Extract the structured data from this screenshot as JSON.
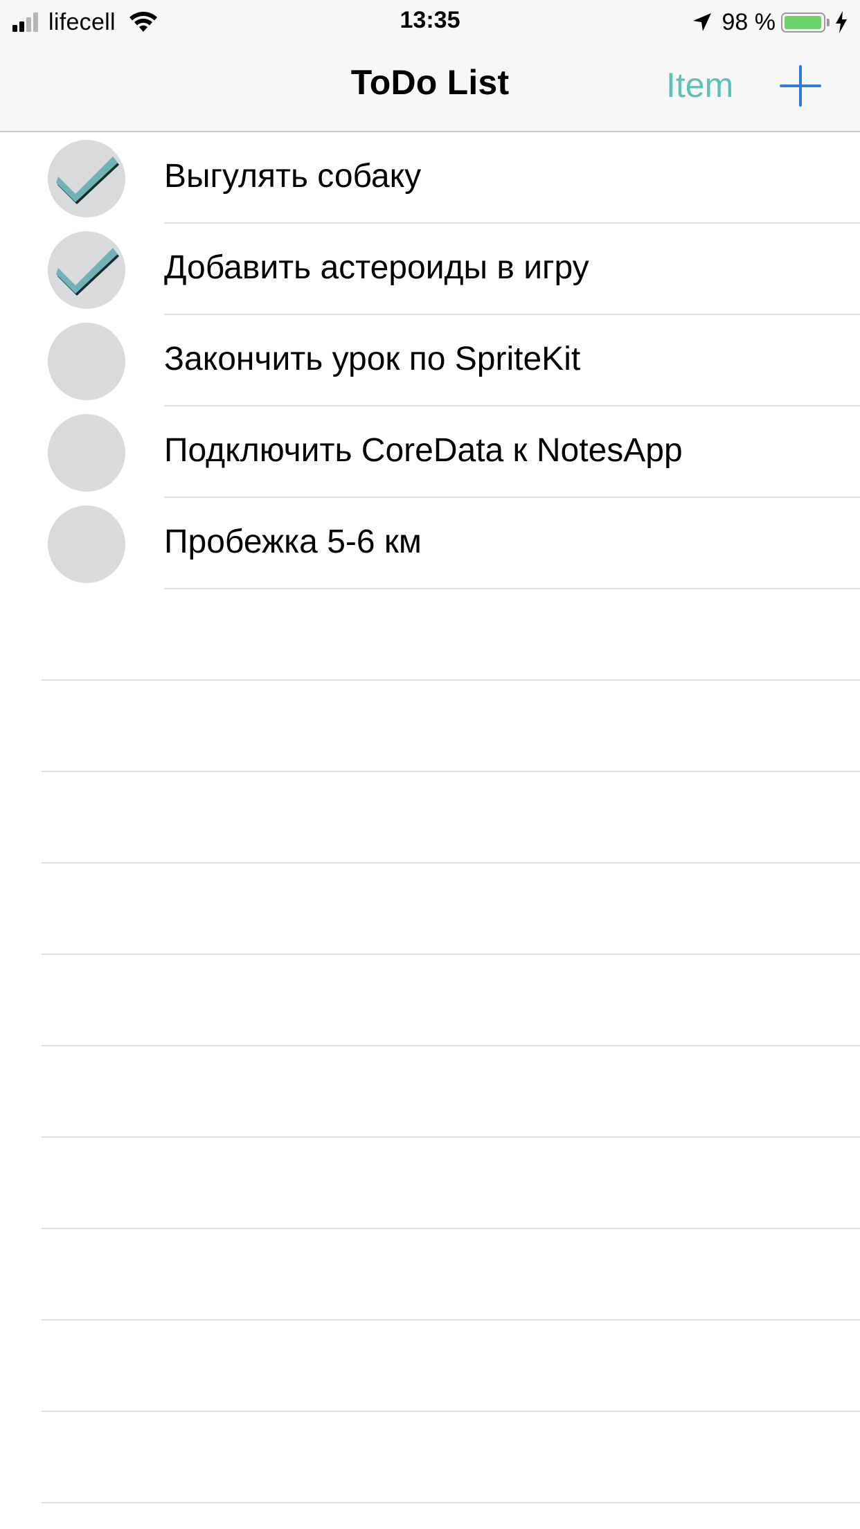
{
  "status_bar": {
    "carrier": "lifecell",
    "time": "13:35",
    "battery_percent": "98 %",
    "battery_level": 0.98,
    "signal_bars_active": 2,
    "signal_bars_total": 4,
    "icons": [
      "signal-icon",
      "wifi-icon",
      "location-arrow-icon",
      "battery-icon",
      "charging-bolt-icon"
    ]
  },
  "nav": {
    "title": "ToDo List",
    "item_button": "Item",
    "add_icon": "plus-icon"
  },
  "colors": {
    "accent_teal": "#5ec2b2",
    "add_blue": "#2f7bdb",
    "check_fill": "#6fb2b8",
    "circle_bg": "#d8dadb",
    "battery_green": "#6ad66a"
  },
  "todos": [
    {
      "label": "Выгулять собаку",
      "done": true
    },
    {
      "label": "Добавить астероиды в игру",
      "done": true
    },
    {
      "label": "Закончить урок по SpriteKit",
      "done": false
    },
    {
      "label": "Подключить CoreData к NotesApp",
      "done": false
    },
    {
      "label": "Пробежка 5-6 км",
      "done": false
    }
  ]
}
